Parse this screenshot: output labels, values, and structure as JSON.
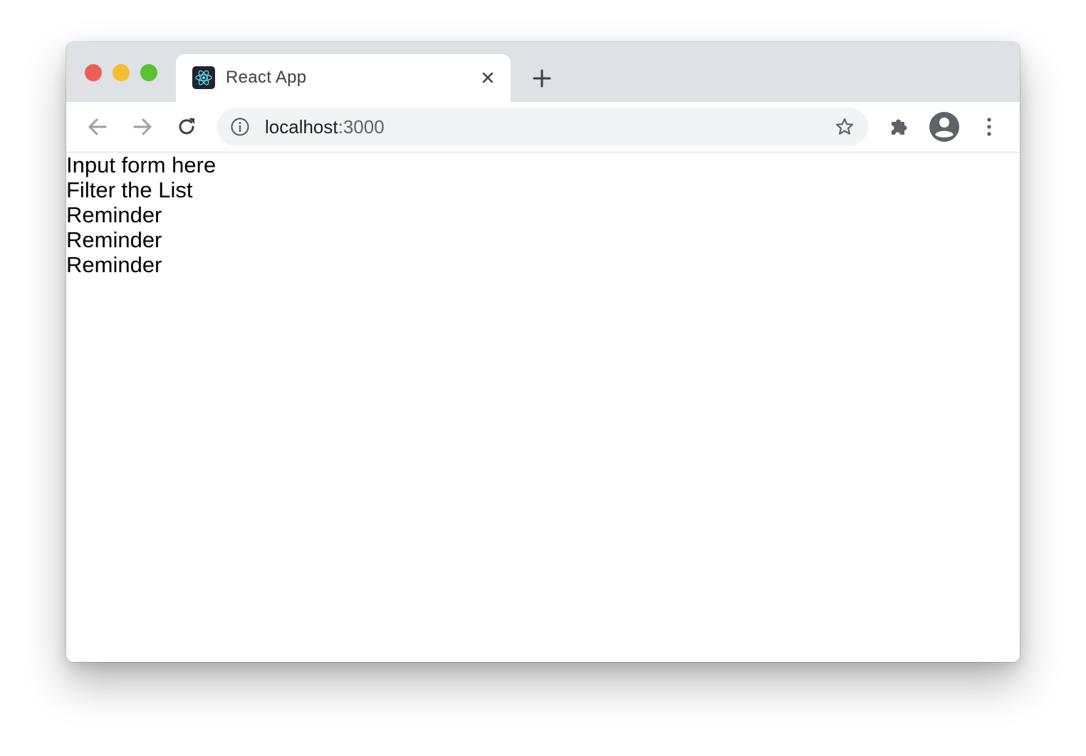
{
  "browser": {
    "tab": {
      "title": "React App",
      "favicon": "react-logo-icon"
    },
    "address_bar": {
      "host": "localhost",
      "port": ":3000"
    },
    "icons": [
      "back-arrow-icon",
      "forward-arrow-icon",
      "reload-icon",
      "info-icon",
      "star-icon",
      "extensions-puzzle-icon",
      "profile-avatar-icon",
      "more-vertical-icon",
      "close-icon",
      "plus-icon"
    ]
  },
  "page": {
    "input_form": "Input form here",
    "filter": "Filter the List",
    "reminders": [
      "Reminder",
      "Reminder",
      "Reminder"
    ]
  }
}
